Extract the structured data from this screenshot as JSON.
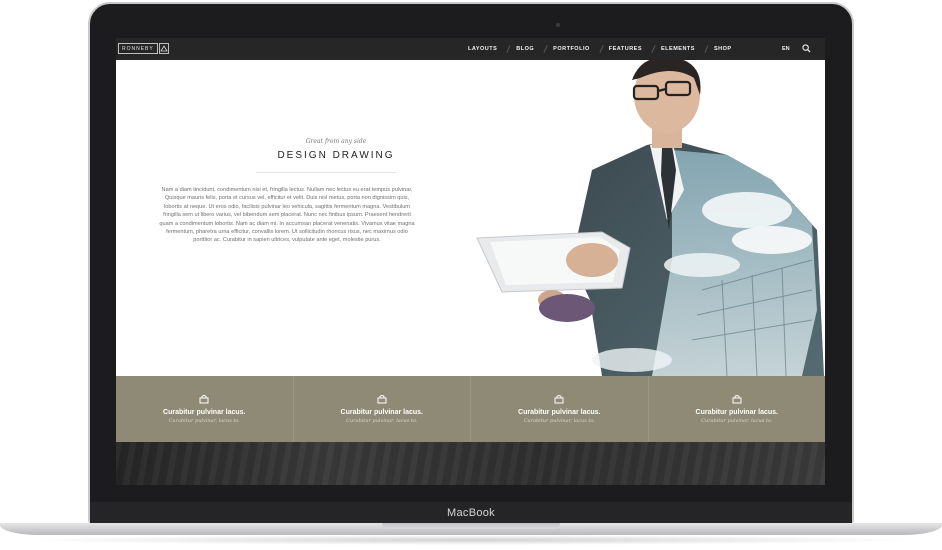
{
  "device": {
    "brand_label": "MacBook"
  },
  "navbar": {
    "logo_text": "RONNEBY",
    "menu": [
      "LAYOUTS",
      "BLOG",
      "PORTFOLIO",
      "FEATURES",
      "ELEMENTS",
      "SHOP"
    ],
    "language": "EN",
    "search_icon": "search-icon"
  },
  "hero": {
    "eyebrow": "Great from any side",
    "title": "DESIGN DRAWING",
    "body": "Nam a diam tincidunt, condimentum nisi et, fringilla lectus. Nullam nec lectus eu erat tempus pulvinar. Quisque mauris felis, porta et cursus vel, efficitur et velit. Duis nisl metus, porta non dignissim quis, lobortis at neque. Ut eros odio, facilisis pulvinar leo vehicula, sagittis fermentum magna. Vestibulum fringilla sem ut libero varius, vel bibendum sem placerat. Nunc nec finibus ipsum. Praesent hendrerit quam a condimentum lobortis. Nam ac diam mi. In accumsan placerat venenatis. Vivamus vitae magna fermentum, pharetra urna efficitur, convallis lorem. Ut sollicitudin rhoncus risus, nec maximus odio porttitor ac. Curabitur in sapien ultrices, vulputate ante eget, molestie purus."
  },
  "features": [
    {
      "icon": "shopping-bag-icon",
      "title": "Curabitur pulvinar lacus.",
      "subtitle": "Curabitur pulvinar, lacus to."
    },
    {
      "icon": "shopping-bag-icon",
      "title": "Curabitur pulvinar lacus.",
      "subtitle": "Curabitur pulvinar, lacus to."
    },
    {
      "icon": "shopping-bag-icon",
      "title": "Curabitur pulvinar lacus.",
      "subtitle": "Curabitur pulvinar, lacus to."
    },
    {
      "icon": "shopping-bag-icon",
      "title": "Curabitur pulvinar lacus.",
      "subtitle": "Curabitur pulvinar, lacus to."
    }
  ],
  "colors": {
    "nav_bg": "#262626",
    "feature_band": "#8f8a75",
    "bezel": "#1c1c1e"
  }
}
